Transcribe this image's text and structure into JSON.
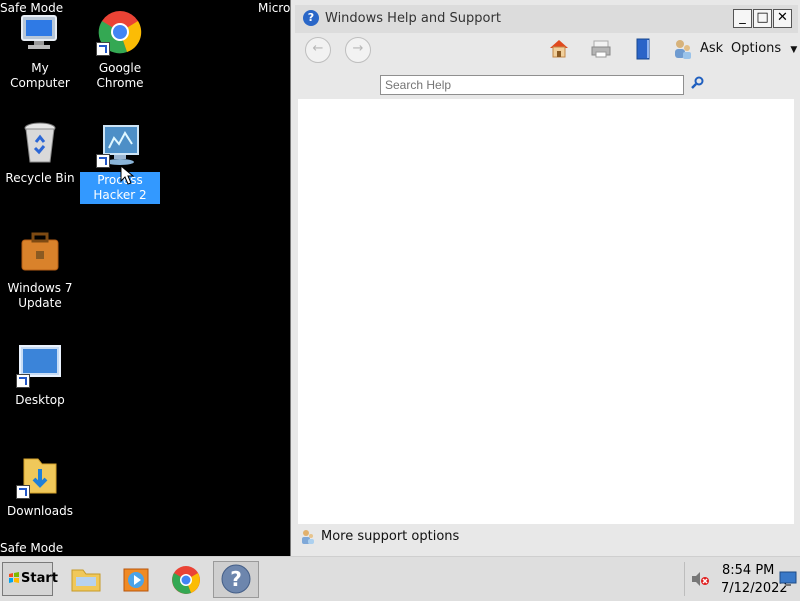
{
  "screen": {
    "safe_mode_top": "Safe Mode",
    "safe_mode_bottom": "Safe Mode",
    "micro_fragment": "Micro"
  },
  "desktop": {
    "icons": [
      {
        "label": "My Computer",
        "icon": "computer-icon"
      },
      {
        "label": "Google Chrome",
        "icon": "chrome-icon"
      },
      {
        "label": "Recycle Bin",
        "icon": "recycle-bin-icon"
      },
      {
        "label": "Process Hacker 2",
        "icon": "process-hacker-icon",
        "selected": true
      },
      {
        "label": "Windows 7 Update",
        "icon": "briefcase-icon"
      },
      {
        "label": "Desktop",
        "icon": "desktop-icon"
      },
      {
        "label": "Downloads",
        "icon": "downloads-folder-icon"
      }
    ]
  },
  "help_window": {
    "title": "Windows Help and Support",
    "toolbar": {
      "ask": "Ask",
      "options": "Options",
      "options_arrow": "▼"
    },
    "search": {
      "placeholder": "Search Help"
    },
    "footer": {
      "support": "More support options"
    },
    "controls": {
      "minimize": "_",
      "maximize": "□",
      "close": "✕"
    }
  },
  "taskbar": {
    "start": "Start",
    "clock": {
      "time": "8:54 PM",
      "date": "7/12/2022"
    }
  },
  "colors": {
    "desktop_bg": "#000000",
    "selection": "#3399ff",
    "window_bg": "#e8e8e8",
    "taskbar_bg": "#dedede"
  }
}
